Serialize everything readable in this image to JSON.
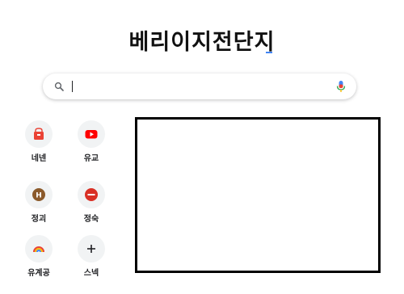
{
  "logo": {
    "text": "베리이지전단지"
  },
  "search": {
    "value": "",
    "placeholder": ""
  },
  "shortcuts": [
    {
      "label": "네넨",
      "icon": "shopping-bag-icon",
      "color": "#ea4335"
    },
    {
      "label": "유교",
      "icon": "youtube-icon",
      "color": "#ff0000"
    },
    {
      "label": "정괴",
      "icon": "h-letter-icon",
      "color": "#8b5a2b"
    },
    {
      "label": "정숙",
      "icon": "red-dash-icon",
      "color": "#d93025"
    },
    {
      "label": "유계공",
      "icon": "rainbow-icon",
      "color": "#4285f4"
    },
    {
      "label": "스넥",
      "icon": "plus-icon",
      "color": "#202124"
    }
  ],
  "colors": {
    "accent": "#4285f4",
    "mic_red": "#ea4335"
  }
}
